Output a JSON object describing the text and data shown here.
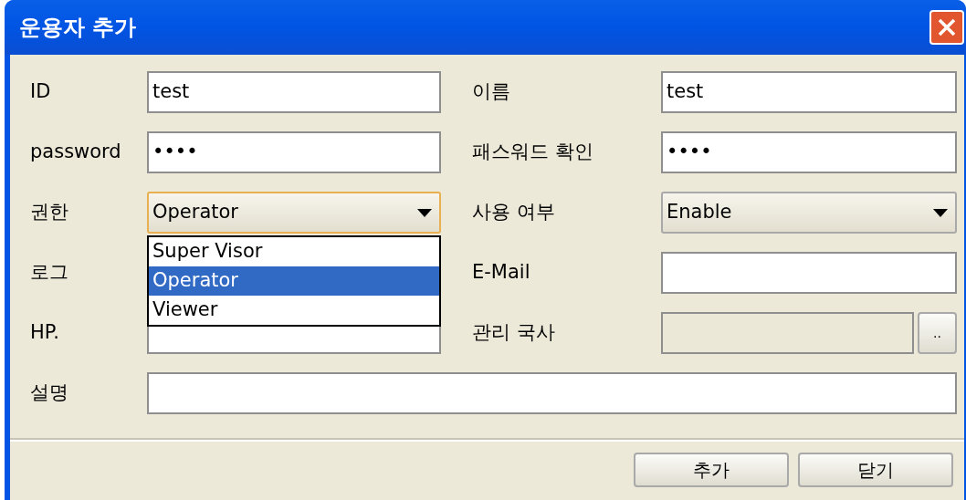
{
  "window": {
    "title": "운용자 추가"
  },
  "left_fields": [
    {
      "label": "ID",
      "kind": "text",
      "value": "test"
    },
    {
      "label": "password",
      "kind": "text",
      "value": "••••"
    },
    {
      "label": "권한",
      "kind": "select",
      "value": "Operator",
      "focused": true,
      "open": true,
      "options": [
        {
          "label": "Super Visor",
          "selected": false
        },
        {
          "label": "Operator",
          "selected": true
        },
        {
          "label": "Viewer",
          "selected": false
        }
      ]
    },
    {
      "label": "로그",
      "kind": "text"
    },
    {
      "label": "HP.",
      "kind": "text"
    }
  ],
  "right_fields": [
    {
      "label": "이름",
      "kind": "text",
      "value": "test"
    },
    {
      "label": "패스워드 확인",
      "kind": "text",
      "value": "••••"
    },
    {
      "label": "사용 여부",
      "kind": "select",
      "value": "Enable",
      "focused": false
    },
    {
      "label": "E-Mail",
      "kind": "text"
    },
    {
      "label": "관리 국사",
      "kind": "browse",
      "disabled": true,
      "button": ".."
    }
  ],
  "wide_fields": [
    {
      "label": "설명",
      "kind": "text"
    }
  ],
  "buttons": [
    "추가",
    "닫기"
  ]
}
